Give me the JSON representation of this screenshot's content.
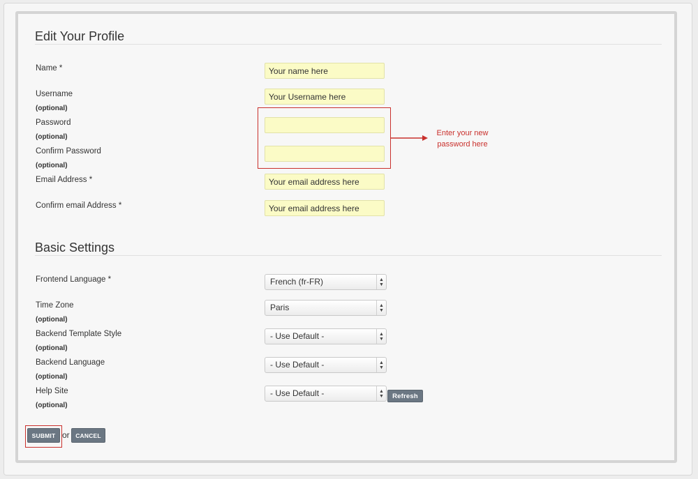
{
  "profile": {
    "title": "Edit Your Profile",
    "fields": [
      {
        "label": "Name *",
        "value": "Your name here"
      },
      {
        "label": "Username",
        "note": "(optional)",
        "value": "Your Username here"
      },
      {
        "label": "Password",
        "note": "(optional)",
        "value": ""
      },
      {
        "label": "Confirm Password",
        "note": "(optional)",
        "value": ""
      },
      {
        "label": "Email Address *",
        "value": "Your email address here"
      },
      {
        "label": "Confirm email Address *",
        "value": "Your email address here"
      }
    ]
  },
  "annotation": {
    "line1": "Enter your new",
    "line2": "password here",
    "color": "#c9302c"
  },
  "basic": {
    "title": "Basic Settings",
    "fields": [
      {
        "label": "Frontend Language *",
        "value": "French (fr-FR)"
      },
      {
        "label": "Time Zone",
        "note": "(optional)",
        "value": "Paris"
      },
      {
        "label": "Backend Template Style",
        "note": "(optional)",
        "value": "- Use Default -"
      },
      {
        "label": "Backend Language",
        "note": "(optional)",
        "value": "- Use Default -"
      },
      {
        "label": "Help Site",
        "note": "(optional)",
        "value": "- Use Default -"
      }
    ],
    "refresh_label": "Refresh"
  },
  "actions": {
    "submit_label": "SUBMIT",
    "or_text": "or",
    "cancel_label": "CANCEL"
  },
  "colors": {
    "input_bg": "#fbfbc6",
    "button_bg": "#6b7783"
  }
}
